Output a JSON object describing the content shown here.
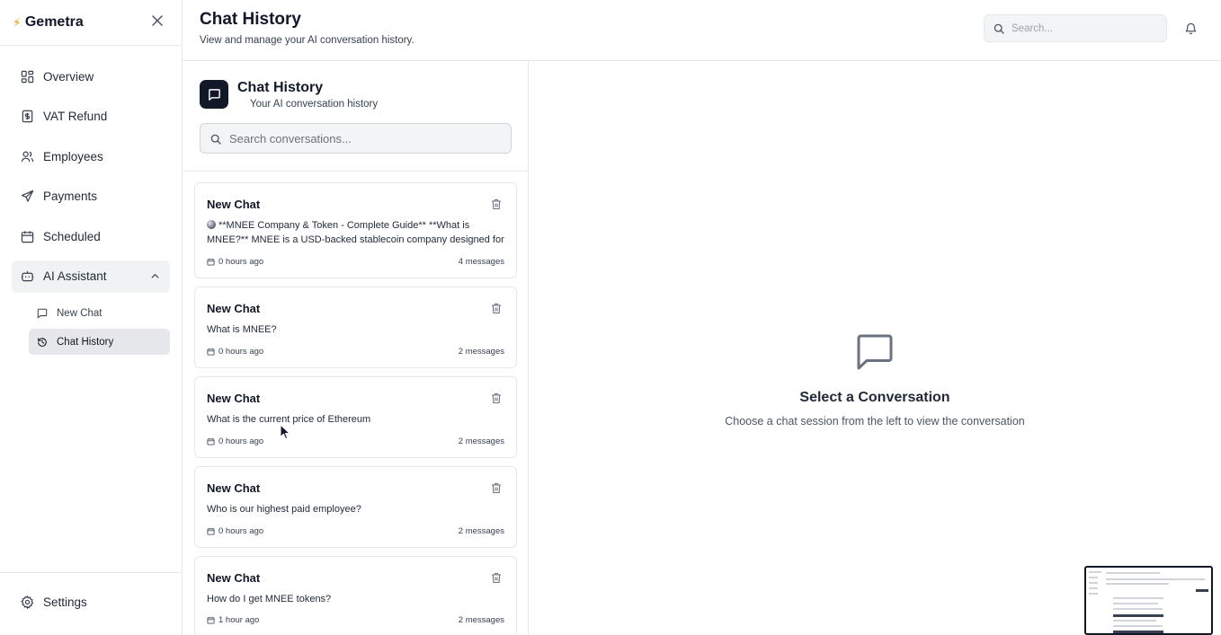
{
  "sidebar": {
    "brand": "Gemetra",
    "items": [
      {
        "label": "Overview",
        "icon": "grid-icon"
      },
      {
        "label": "VAT Refund",
        "icon": "receipt-icon"
      },
      {
        "label": "Employees",
        "icon": "users-icon"
      },
      {
        "label": "Payments",
        "icon": "send-icon"
      },
      {
        "label": "Scheduled",
        "icon": "calendar-icon"
      },
      {
        "label": "AI Assistant",
        "icon": "bot-icon"
      }
    ],
    "sub_items": [
      {
        "label": "New Chat",
        "icon": "message-square-icon"
      },
      {
        "label": "Chat History",
        "icon": "history-icon"
      }
    ],
    "settings_label": "Settings"
  },
  "header": {
    "title": "Chat History",
    "subtitle": "View and manage your AI conversation history.",
    "search_placeholder": "Search..."
  },
  "list": {
    "title": "Chat History",
    "subtitle": "Your AI conversation history",
    "search_placeholder": "Search conversations...",
    "chats": [
      {
        "title": "New Chat",
        "preview": "**MNEE Company & Token - Complete Guide** **What is MNEE?** MNEE is a USD-backed stablecoin company designed for",
        "time": "0 hours ago",
        "count": "4 messages"
      },
      {
        "title": "New Chat",
        "preview": "What is MNEE?",
        "time": "0 hours ago",
        "count": "2 messages"
      },
      {
        "title": "New Chat",
        "preview": "What is the current price of Ethereum",
        "time": "0 hours ago",
        "count": "2 messages"
      },
      {
        "title": "New Chat",
        "preview": "Who is our highest paid employee?",
        "time": "0 hours ago",
        "count": "2 messages"
      },
      {
        "title": "New Chat",
        "preview": "How do I get MNEE tokens?",
        "time": "1 hour ago",
        "count": "2 messages"
      }
    ]
  },
  "empty_state": {
    "title": "Select a Conversation",
    "description": "Choose a chat session from the left to view the conversation"
  },
  "colors": {
    "accent": "#111827",
    "bolt": "#f59e0b",
    "active_bg": "#f1f2f4"
  }
}
